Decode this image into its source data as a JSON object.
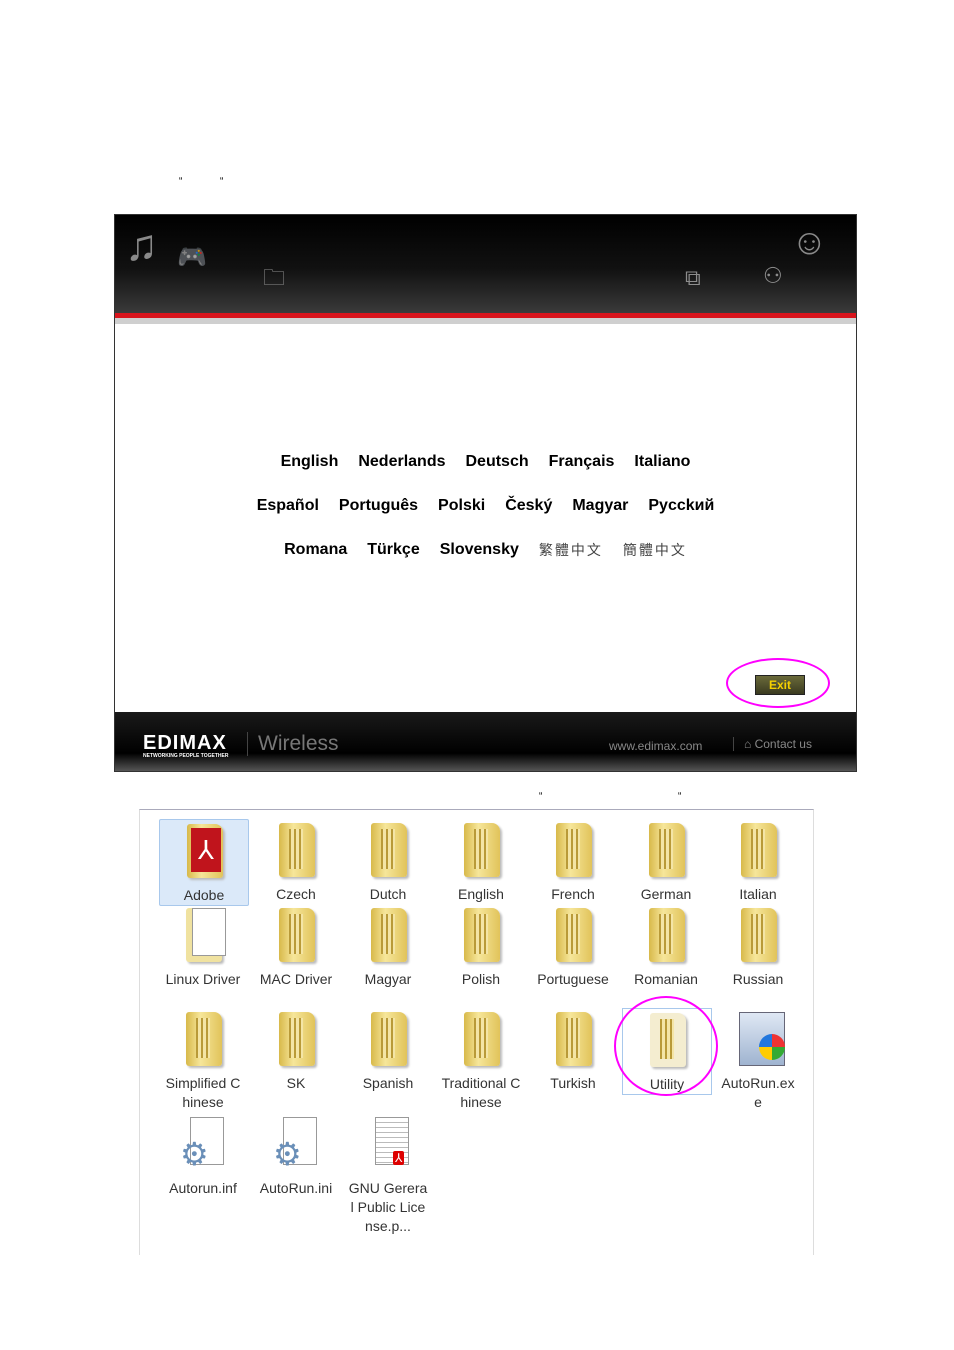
{
  "quotes": {
    "top": [
      "“",
      "“"
    ],
    "middle": [
      "“",
      "“"
    ]
  },
  "installer": {
    "languages": [
      [
        "English",
        "Nederlands",
        "Deutsch",
        "Français",
        "Italiano"
      ],
      [
        "Español",
        "Português",
        "Polski",
        "Český",
        "Magyar",
        "Pycckий"
      ],
      [
        "Romana",
        "Türkçe",
        "Slovensky",
        "繁體中文",
        "簡體中文"
      ]
    ],
    "exit_label": "Exit",
    "footer": {
      "logo": "EDIMAX",
      "logo_tagline": "NETWORKING PEOPLE TOGETHER",
      "product": "Wireless",
      "website": "www.edimax.com",
      "contact": "Contact us"
    },
    "colors": {
      "accent_red": "#d8141c",
      "highlight": "#ff00ff",
      "exit_text": "#f5d000"
    }
  },
  "explorer": {
    "items": [
      {
        "label": "Adobe",
        "icon": "adobe-folder-icon",
        "selected": true
      },
      {
        "label": "Czech",
        "icon": "folder-icon"
      },
      {
        "label": "Dutch",
        "icon": "folder-icon"
      },
      {
        "label": "English",
        "icon": "folder-icon"
      },
      {
        "label": "French",
        "icon": "folder-icon"
      },
      {
        "label": "German",
        "icon": "folder-icon"
      },
      {
        "label": "Italian",
        "icon": "folder-icon"
      },
      {
        "label": "Linux Driver",
        "icon": "document-folder-icon"
      },
      {
        "label": "MAC Driver",
        "icon": "folder-icon"
      },
      {
        "label": "Magyar",
        "icon": "folder-icon"
      },
      {
        "label": "Polish",
        "icon": "folder-icon"
      },
      {
        "label": "Portuguese",
        "icon": "folder-icon"
      },
      {
        "label": "Romanian",
        "icon": "folder-icon"
      },
      {
        "label": "Russian",
        "icon": "folder-icon"
      },
      {
        "label": "Simplified Chinese",
        "icon": "folder-icon"
      },
      {
        "label": "SK",
        "icon": "folder-icon"
      },
      {
        "label": "Spanish",
        "icon": "folder-icon"
      },
      {
        "label": "Traditional Chinese",
        "icon": "folder-icon"
      },
      {
        "label": "Turkish",
        "icon": "folder-icon"
      },
      {
        "label": "Utility",
        "icon": "open-folder-icon",
        "highlighted": true
      },
      {
        "label": "AutoRun.exe",
        "icon": "exe-icon"
      },
      {
        "label": "Autorun.inf",
        "icon": "settings-file-icon"
      },
      {
        "label": "AutoRun.ini",
        "icon": "settings-file-icon"
      },
      {
        "label": "GNU Gereral Public License.p...",
        "icon": "pdf-file-icon"
      }
    ]
  }
}
